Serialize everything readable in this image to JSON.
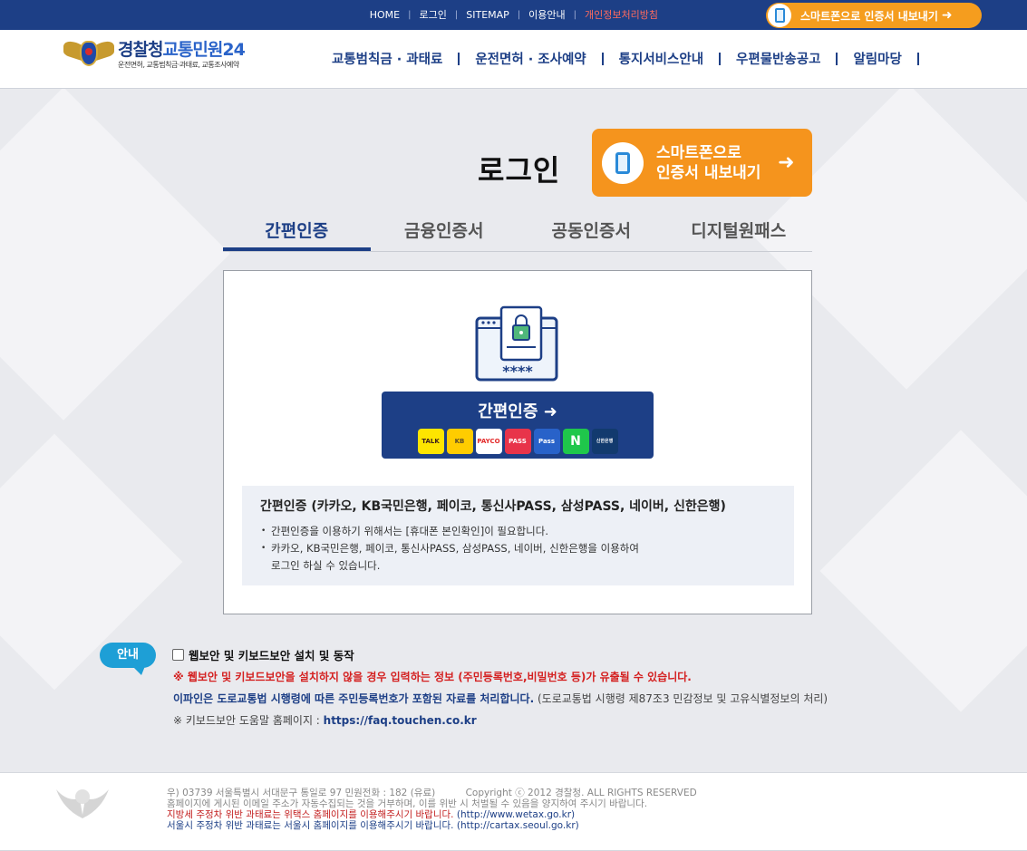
{
  "topnav": {
    "items": [
      "HOME",
      "로그인",
      "SITEMAP",
      "이용안내",
      "개인정보처리방침"
    ],
    "export_label": "스마트폰으로 인증서 내보내기"
  },
  "logo": {
    "name_part1": "경찰청",
    "name_part2": "교통민원24",
    "subtitle": "운전면허, 교통범칙금·과태료, 교통조사예약"
  },
  "mainnav": [
    "교통범칙금 · 과태료",
    "운전면허 · 조사예약",
    "통지서비스안내",
    "우편물반송공고",
    "알림마당"
  ],
  "login": {
    "title": "로그인",
    "export_line1": "스마트폰으로",
    "export_line2": "인증서 내보내기"
  },
  "tabs": [
    "간편인증",
    "금융인증서",
    "공동인증서",
    "디지털원패스"
  ],
  "panel": {
    "button_label": "간편인증",
    "logos": [
      "TALK",
      "KB",
      "PAYCO",
      "PASS",
      "Pass",
      "N",
      "신한은행"
    ],
    "info_title": "간편인증 (카카오, KB국민은행, 페이코, 통신사PASS, 삼성PASS, 네이버, 신한은행)",
    "info_item1": "간편인증을 이용하기 위해서는 [휴대폰 본인확인]이 필요합니다.",
    "info_item2a": "카카오, KB국민은행, 페이코, 통신사PASS, 삼성PASS, 네이버, 신한은행을 이용하여",
    "info_item2b": "로그인 하실 수 있습니다."
  },
  "notice": {
    "badge": "안내",
    "checkbox_label": "웹보안 및 키보드보안 설치 및 동작",
    "warning": "※ 웹보안 및 키보드보안을 설치하지 않을 경우 입력하는 정보 (주민등록번호,비밀번호 등)가 유출될 수 있습니다.",
    "processing": "이파인은 도로교통법 시행령에 따른 주민등록번호가 포함된 자료를 처리합니다.",
    "processing_extra": "(도로교통법 시행령 제87조3 민감정보 및 고유식별정보의 처리)",
    "keyboard_help_prefix": "※ 키보드보안 도움말 홈페이지 : ",
    "keyboard_help_link": "https://faq.touchen.co.kr"
  },
  "footer": {
    "address": "우) 03739 서울특별시 서대문구 통일로 97  민원전화 : 182 (유료)",
    "copyright": "Copyright ⓒ 2012 경찰청. ALL RIGHTS RESERVED",
    "email_notice": "홈페이지에 게시된 이메일 주소가 자동수집되는 것을 거부하며, 이를 위반 시 처벌될 수 있음을 양지하여 주시기 바랍니다.",
    "local_tax": "지방세 주정차 위반 과태료는 위택스 홈페이지를 이용해주시기 바랍니다.",
    "local_tax_url": "(http://www.wetax.go.kr)",
    "seoul": "서울시 주정차 위반 과태료는 서울시 홈페이지를 이용해주시기 바랍니다.",
    "seoul_url": "(http://cartax.seoul.go.kr)"
  },
  "colors": {
    "primary": "#1d3f86",
    "accent": "#f5941d",
    "warning": "#d42020",
    "guide": "#1e9fd6"
  }
}
